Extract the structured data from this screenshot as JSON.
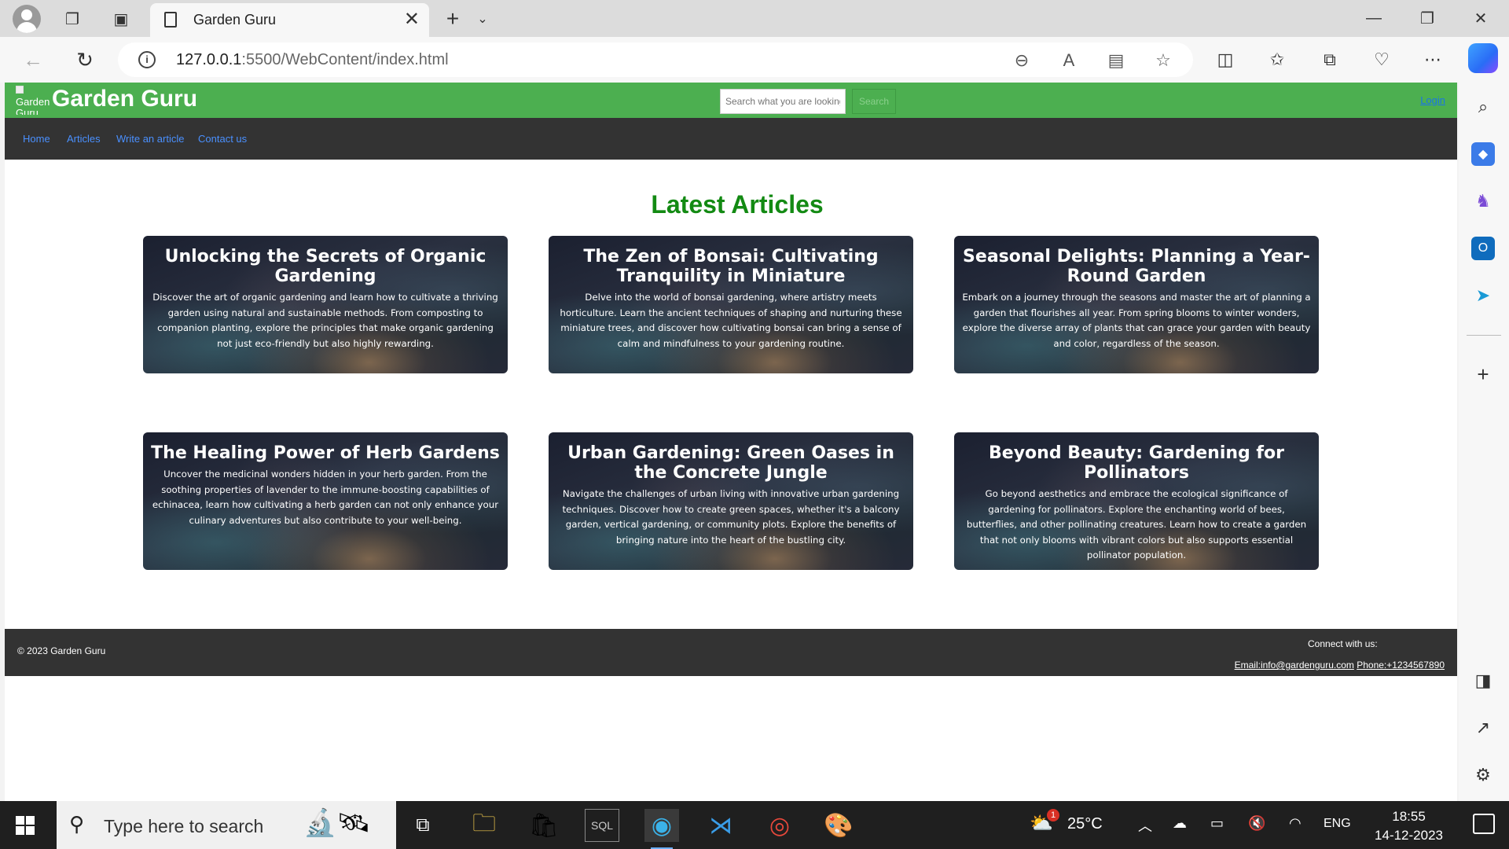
{
  "browser": {
    "tab_title": "Garden Guru",
    "url_host": "127.0.0.1",
    "url_path": ":5500/WebContent/index.html"
  },
  "site": {
    "logo_alt": "Garden Guru",
    "title": "Garden Guru",
    "search_placeholder": "Search what you are looking for",
    "search_button": "Search",
    "login": "Login",
    "nav": [
      "Home",
      "Articles",
      "Write an article",
      "Contact us"
    ],
    "section_title": "Latest Articles",
    "articles": [
      {
        "title": "Unlocking the Secrets of Organic Gardening",
        "text": "Discover the art of organic gardening and learn how to cultivate a thriving garden using natural and sustainable methods. From composting to companion planting, explore the principles that make organic gardening not just eco-friendly but also highly rewarding."
      },
      {
        "title": "The Zen of Bonsai: Cultivating Tranquility in Miniature",
        "text": "Delve into the world of bonsai gardening, where artistry meets horticulture. Learn the ancient techniques of shaping and nurturing these miniature trees, and discover how cultivating bonsai can bring a sense of calm and mindfulness to your gardening routine."
      },
      {
        "title": "Seasonal Delights: Planning a Year-Round Garden",
        "text": "Embark on a journey through the seasons and master the art of planning a garden that flourishes all year. From spring blooms to winter wonders, explore the diverse array of plants that can grace your garden with beauty and color, regardless of the season."
      },
      {
        "title": "The Healing Power of Herb Gardens",
        "text": "Uncover the medicinal wonders hidden in your herb garden. From the soothing properties of lavender to the immune-boosting capabilities of echinacea, learn how cultivating a herb garden can not only enhance your culinary adventures but also contribute to your well-being."
      },
      {
        "title": "Urban Gardening: Green Oases in the Concrete Jungle",
        "text": "Navigate the challenges of urban living with innovative urban gardening techniques. Discover how to create green spaces, whether it's a balcony garden, vertical gardening, or community plots. Explore the benefits of bringing nature into the heart of the bustling city."
      },
      {
        "title": "Beyond Beauty: Gardening for Pollinators",
        "text": "Go beyond aesthetics and embrace the ecological significance of gardening for pollinators. Explore the enchanting world of bees, butterflies, and other pollinating creatures. Learn how to create a garden that not only blooms with vibrant colors but also supports essential pollinator population."
      }
    ],
    "footer": {
      "copyright": "© 2023 Garden Guru",
      "connect": "Connect with us:",
      "email": "Email:info@gardenguru.com",
      "phone": "Phone:+1234567890"
    }
  },
  "taskbar": {
    "search_text": "Type here to search",
    "weather": "25°C",
    "language": "ENG",
    "time": "18:55",
    "date": "14-12-2023",
    "weather_badge": "1"
  },
  "colors": {
    "header_green": "#4caf50",
    "nav_dark": "#333333",
    "title_green": "#138a13",
    "link_blue": "#4a90ff"
  }
}
